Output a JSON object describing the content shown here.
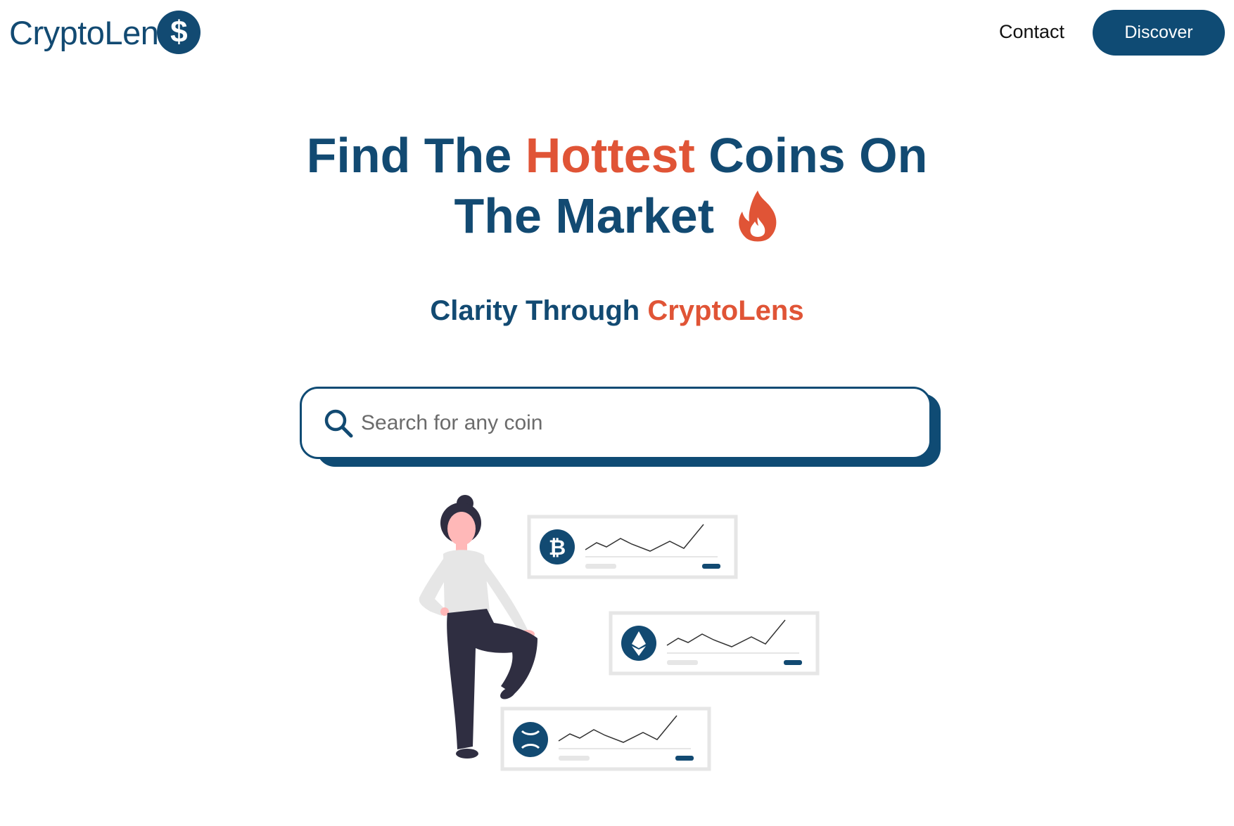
{
  "header": {
    "logo_text": "CryptoLen",
    "logo_symbol": "$",
    "nav_contact": "Contact",
    "nav_discover": "Discover"
  },
  "hero": {
    "line1_part1": "Find The ",
    "line1_hot": "Hottest",
    "line1_part2": " Coins On",
    "line2": "The Market"
  },
  "subtitle": {
    "part1": "Clarity Through ",
    "part2": "CryptoLens"
  },
  "search": {
    "placeholder": "Search for any coin"
  },
  "colors": {
    "brand_navy": "#124a72",
    "accent_orange": "#e05436",
    "card_border": "#e6e6e6"
  },
  "illustration": {
    "cards": [
      {
        "coin": "bitcoin-icon",
        "glyph": "₿"
      },
      {
        "coin": "ethereum-icon",
        "glyph": "◆"
      },
      {
        "coin": "xrp-icon",
        "glyph": "✕"
      }
    ]
  }
}
